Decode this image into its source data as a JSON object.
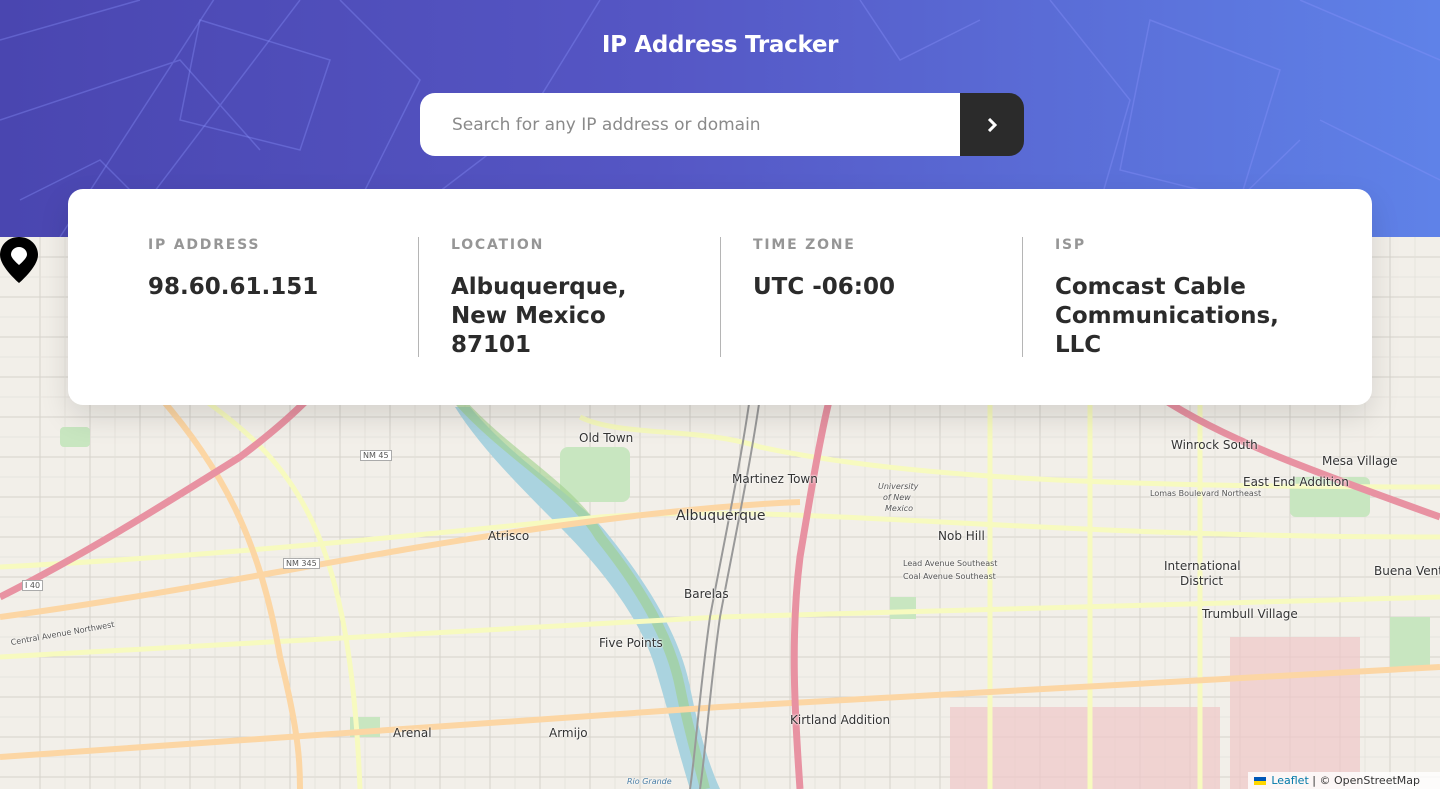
{
  "header": {
    "title": "IP Address Tracker",
    "search": {
      "placeholder": "Search for any IP address or domain",
      "value": "",
      "submit_icon": "chevron-right-icon"
    }
  },
  "info": {
    "ip": {
      "label": "IP ADDRESS",
      "value": "98.60.61.151"
    },
    "location": {
      "label": "LOCATION",
      "value": "Albuquerque, New Mexico 87101"
    },
    "timezone": {
      "label": "TIME ZONE",
      "value": "UTC -06:00"
    },
    "isp": {
      "label": "ISP",
      "value": "Comcast Cable Communications, LLC"
    }
  },
  "map": {
    "places": {
      "old_town": "Old Town",
      "martinez_town": "Martinez Town",
      "albuquerque": "Albuquerque",
      "atrisco": "Atrisco",
      "barelas": "Barelas",
      "five_points": "Five Points",
      "arenal": "Arenal",
      "armijo": "Armijo",
      "kirtland": "Kirtland Addition",
      "nob_hill": "Nob Hill",
      "winrock": "Winrock South",
      "mesa_village": "Mesa Village",
      "east_end": "East End Addition",
      "international": "International",
      "district": "District",
      "trumbull": "Trumbull Village",
      "buena": "Buena Vente",
      "unm_1": "University",
      "unm_2": "of New",
      "unm_3": "Mexico",
      "lead_ave": "Lead Avenue Southeast",
      "coal_ave": "Coal Avenue Southeast",
      "lomas": "Lomas Boulevard Northeast",
      "central": "Central Avenue Northwest",
      "nm45": "NM 45",
      "nm345": "NM 345",
      "i40": "I 40",
      "rio_grande": "Rio Grande"
    },
    "marker_icon": "location-pin-icon",
    "attribution": {
      "leaflet": "Leaflet",
      "osm": "© OpenStreetMap"
    }
  },
  "colors": {
    "header_gradient_start": "#4a46b0",
    "header_gradient_end": "#5f82e8",
    "button_bg": "#2b2b2b",
    "text_dark": "#2b2b2b",
    "label_gray": "#969696"
  }
}
